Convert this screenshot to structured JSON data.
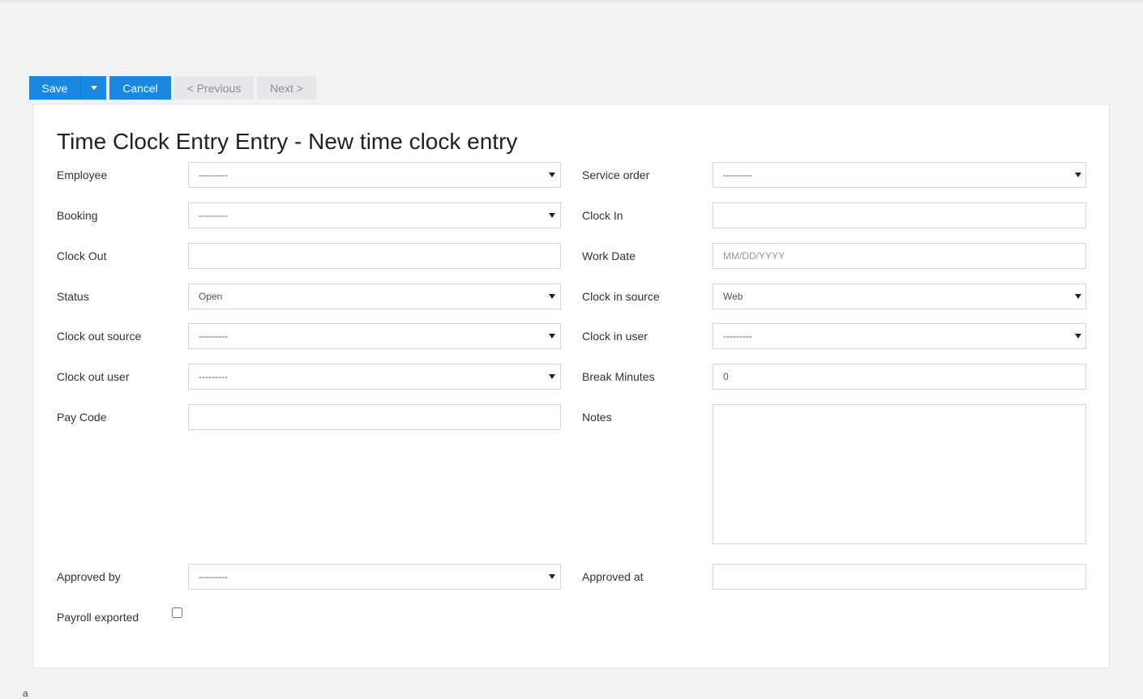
{
  "toolbar": {
    "save_label": "Save",
    "cancel_label": "Cancel",
    "previous_label": "< Previous",
    "next_label": "Next >"
  },
  "form": {
    "title": "Time Clock Entry Entry - New time clock entry",
    "employee": {
      "label": "Employee",
      "value": "---------"
    },
    "service_order": {
      "label": "Service order",
      "value": "---------"
    },
    "booking": {
      "label": "Booking",
      "value": "---------"
    },
    "clock_in": {
      "label": "Clock In",
      "value": ""
    },
    "clock_out": {
      "label": "Clock Out",
      "value": ""
    },
    "work_date": {
      "label": "Work Date",
      "value": "",
      "placeholder": "MM/DD/YYYY"
    },
    "status": {
      "label": "Status",
      "value": "Open"
    },
    "clock_in_source": {
      "label": "Clock in source",
      "value": "Web"
    },
    "clock_out_source": {
      "label": "Clock out source",
      "value": "---------"
    },
    "clock_in_user": {
      "label": "Clock in user",
      "value": "---------"
    },
    "clock_out_user": {
      "label": "Clock out user",
      "value": "---------"
    },
    "break_minutes": {
      "label": "Break Minutes",
      "value": "0"
    },
    "pay_code": {
      "label": "Pay Code",
      "value": ""
    },
    "notes": {
      "label": "Notes",
      "value": ""
    },
    "approved_by": {
      "label": "Approved by",
      "value": "---------"
    },
    "approved_at": {
      "label": "Approved at",
      "value": ""
    },
    "payroll_exported": {
      "label": "Payroll exported",
      "checked": false
    }
  },
  "footer": {
    "glyph": "a"
  }
}
